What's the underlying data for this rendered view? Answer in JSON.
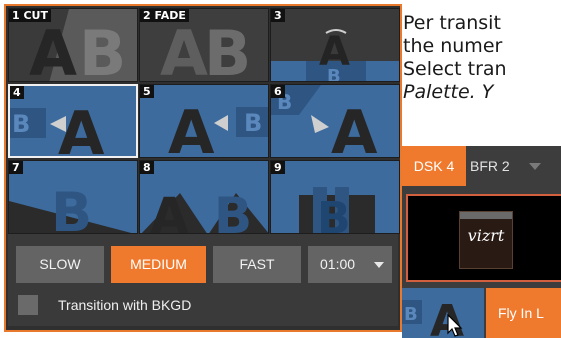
{
  "doc_text": {
    "line1": "Per transit",
    "line2": "the numer",
    "line3": "Select tran",
    "line4": "Palette.  Y"
  },
  "palette": {
    "tiles": [
      {
        "label": "1 CUT"
      },
      {
        "label": "2 FADE"
      },
      {
        "label": "3"
      },
      {
        "label": "4"
      },
      {
        "label": "5"
      },
      {
        "label": "6"
      },
      {
        "label": "7"
      },
      {
        "label": "8"
      },
      {
        "label": "9"
      }
    ],
    "selected_tile": "4"
  },
  "speed": {
    "slow": "SLOW",
    "medium": "MEDIUM",
    "fast": "FAST",
    "duration": "01:00",
    "active": "MEDIUM"
  },
  "bkgd": {
    "label": "Transition with BKGD",
    "checked": false
  },
  "dsk": {
    "tab_label": "DSK 4",
    "bfr_label": "BFR 2",
    "preview_logo": "vizrt",
    "fly_label": "Fly In L"
  },
  "colors": {
    "accent": "#ef7a2d",
    "tile_blue": "#3d6b9e",
    "tile_dark": "#2b2b2b",
    "panel": "#3a3a3a"
  }
}
